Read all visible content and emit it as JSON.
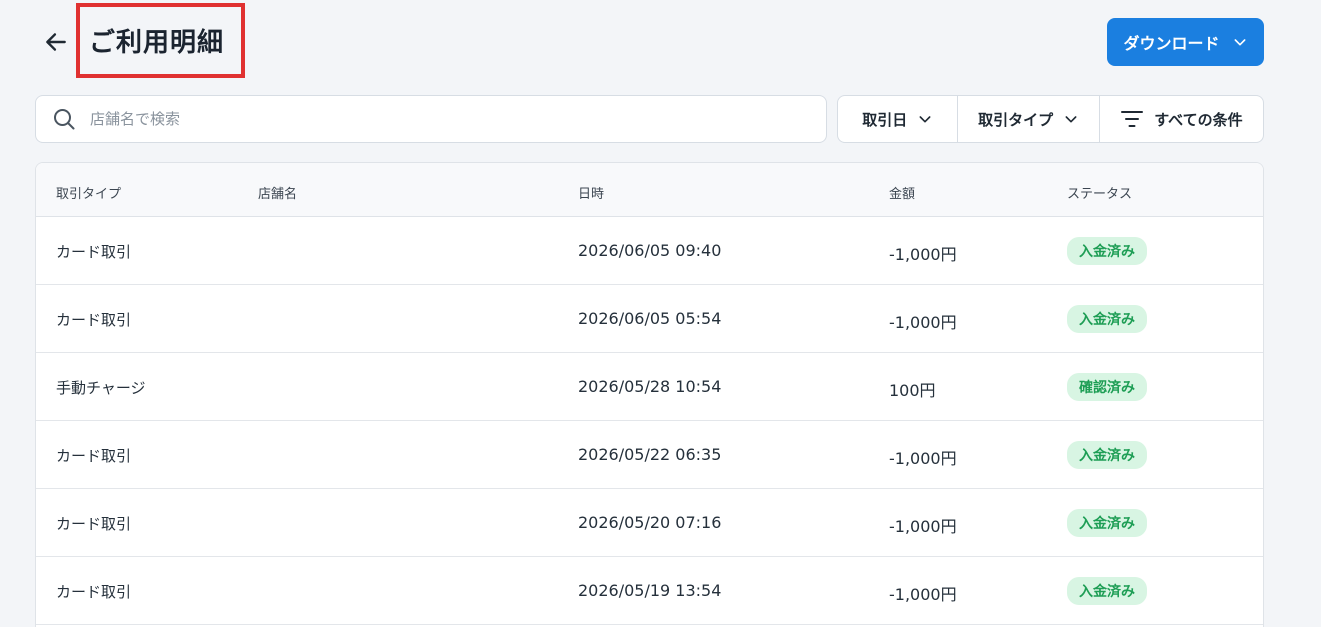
{
  "header": {
    "title": "ご利用明細",
    "download_label": "ダウンロード"
  },
  "search": {
    "placeholder": "店舗名で検索",
    "value": ""
  },
  "filters": {
    "date_label": "取引日",
    "type_label": "取引タイプ",
    "all_conditions_label": "すべての条件"
  },
  "table": {
    "columns": [
      "取引タイプ",
      "店舗名",
      "日時",
      "金額",
      "ステータス"
    ],
    "rows": [
      {
        "type": "カード取引",
        "store": "",
        "date": "2026/06/05 09:40",
        "amount": "-1,000円",
        "status": "入金済み"
      },
      {
        "type": "カード取引",
        "store": "",
        "date": "2026/06/05 05:54",
        "amount": "-1,000円",
        "status": "入金済み"
      },
      {
        "type": "手動チャージ",
        "store": "",
        "date": "2026/05/28 10:54",
        "amount": "100円",
        "status": "確認済み"
      },
      {
        "type": "カード取引",
        "store": "",
        "date": "2026/05/22 06:35",
        "amount": "-1,000円",
        "status": "入金済み"
      },
      {
        "type": "カード取引",
        "store": "",
        "date": "2026/05/20 07:16",
        "amount": "-1,000円",
        "status": "入金済み"
      },
      {
        "type": "カード取引",
        "store": "",
        "date": "2026/05/19 13:54",
        "amount": "-1,000円",
        "status": "入金済み"
      }
    ]
  },
  "colors": {
    "accent": "#1b7fe0",
    "badge_bg": "#d8f5e3",
    "badge_text": "#1e9e55",
    "highlight_border": "#e03131"
  }
}
